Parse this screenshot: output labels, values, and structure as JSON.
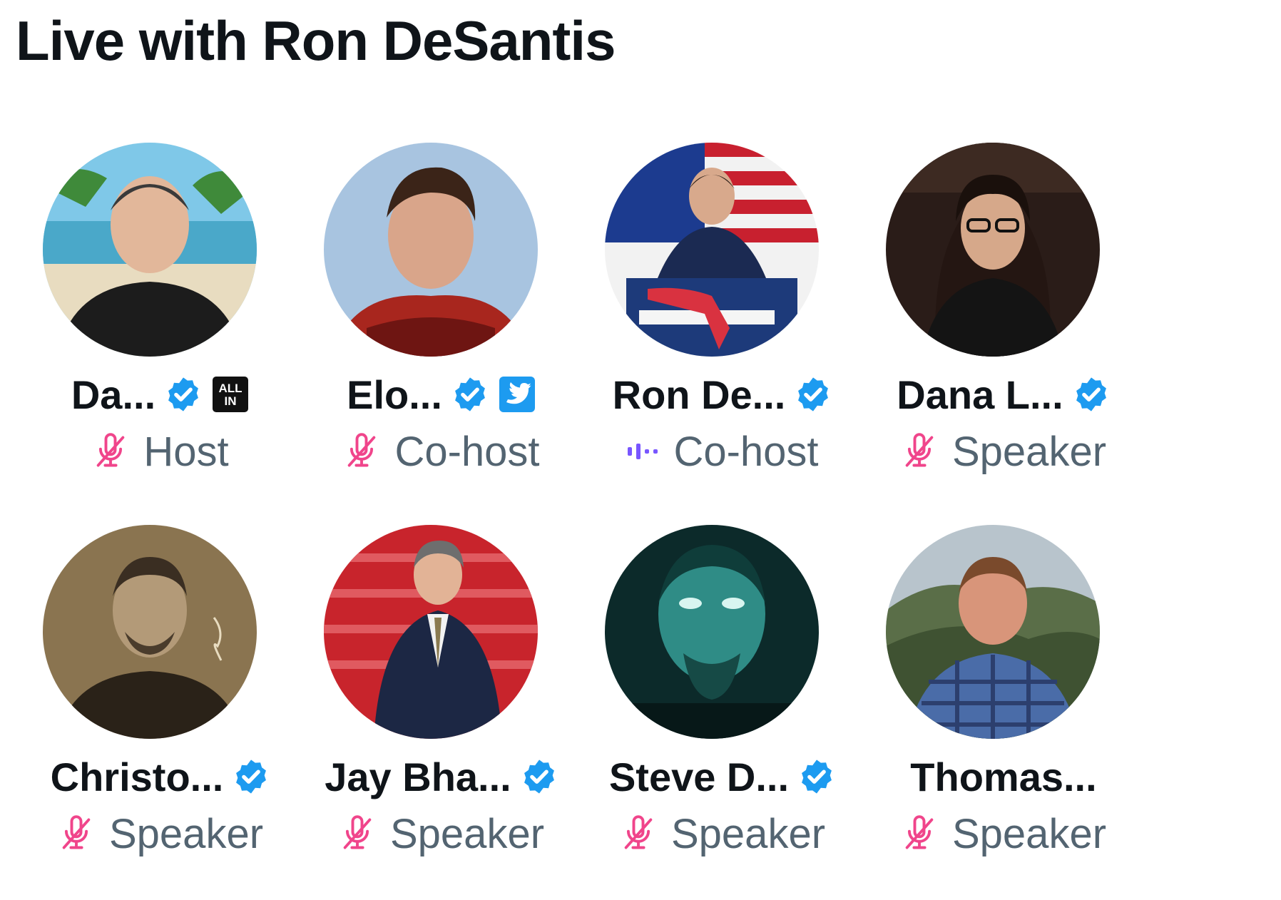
{
  "space": {
    "title": "Live with Ron DeSantis"
  },
  "colors": {
    "verified": "#1d9bf0",
    "muted_mic": "#f0458b",
    "audio": "#7856ff",
    "role_text": "#536471"
  },
  "speakers": [
    {
      "name": "Da...",
      "role": "Host",
      "mic": "mic-muted-icon",
      "affiliation": "all-in-badge-icon",
      "affiliation_text": "ALL IN"
    },
    {
      "name": "Elo...",
      "role": "Co-host",
      "mic": "mic-muted-icon",
      "affiliation": "twitter-badge-icon"
    },
    {
      "name": "Ron De...",
      "role": "Co-host",
      "mic": "speaking-bars-icon"
    },
    {
      "name": "Dana L...",
      "role": "Speaker",
      "mic": "mic-muted-icon"
    },
    {
      "name": "Christo...",
      "role": "Speaker",
      "mic": "mic-muted-icon"
    },
    {
      "name": "Jay Bha...",
      "role": "Speaker",
      "mic": "mic-muted-icon"
    },
    {
      "name": "Steve D...",
      "role": "Speaker",
      "mic": "mic-muted-icon"
    },
    {
      "name": "Thomas...",
      "role": "Speaker",
      "mic": "mic-muted-icon"
    }
  ]
}
